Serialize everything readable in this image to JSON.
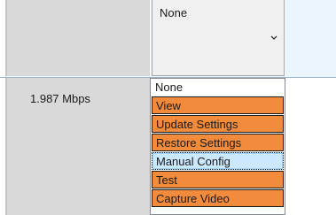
{
  "combo": {
    "value": "None",
    "chevron_icon": "chevron-down-icon"
  },
  "table": {
    "row2_rate": "1.987 Mbps"
  },
  "dropdown": {
    "items": [
      {
        "label": "None",
        "style": "plain"
      },
      {
        "label": "View",
        "style": "orange"
      },
      {
        "label": "Update Settings",
        "style": "orange"
      },
      {
        "label": "Restore Settings",
        "style": "orange"
      },
      {
        "label": "Manual Config",
        "style": "selected"
      },
      {
        "label": "Test",
        "style": "orange"
      },
      {
        "label": "Capture Video",
        "style": "orange"
      }
    ],
    "colors": {
      "orange": "#f28c3c",
      "selected": "#cce8ff",
      "row_highlight": "#eaf5fd"
    }
  }
}
